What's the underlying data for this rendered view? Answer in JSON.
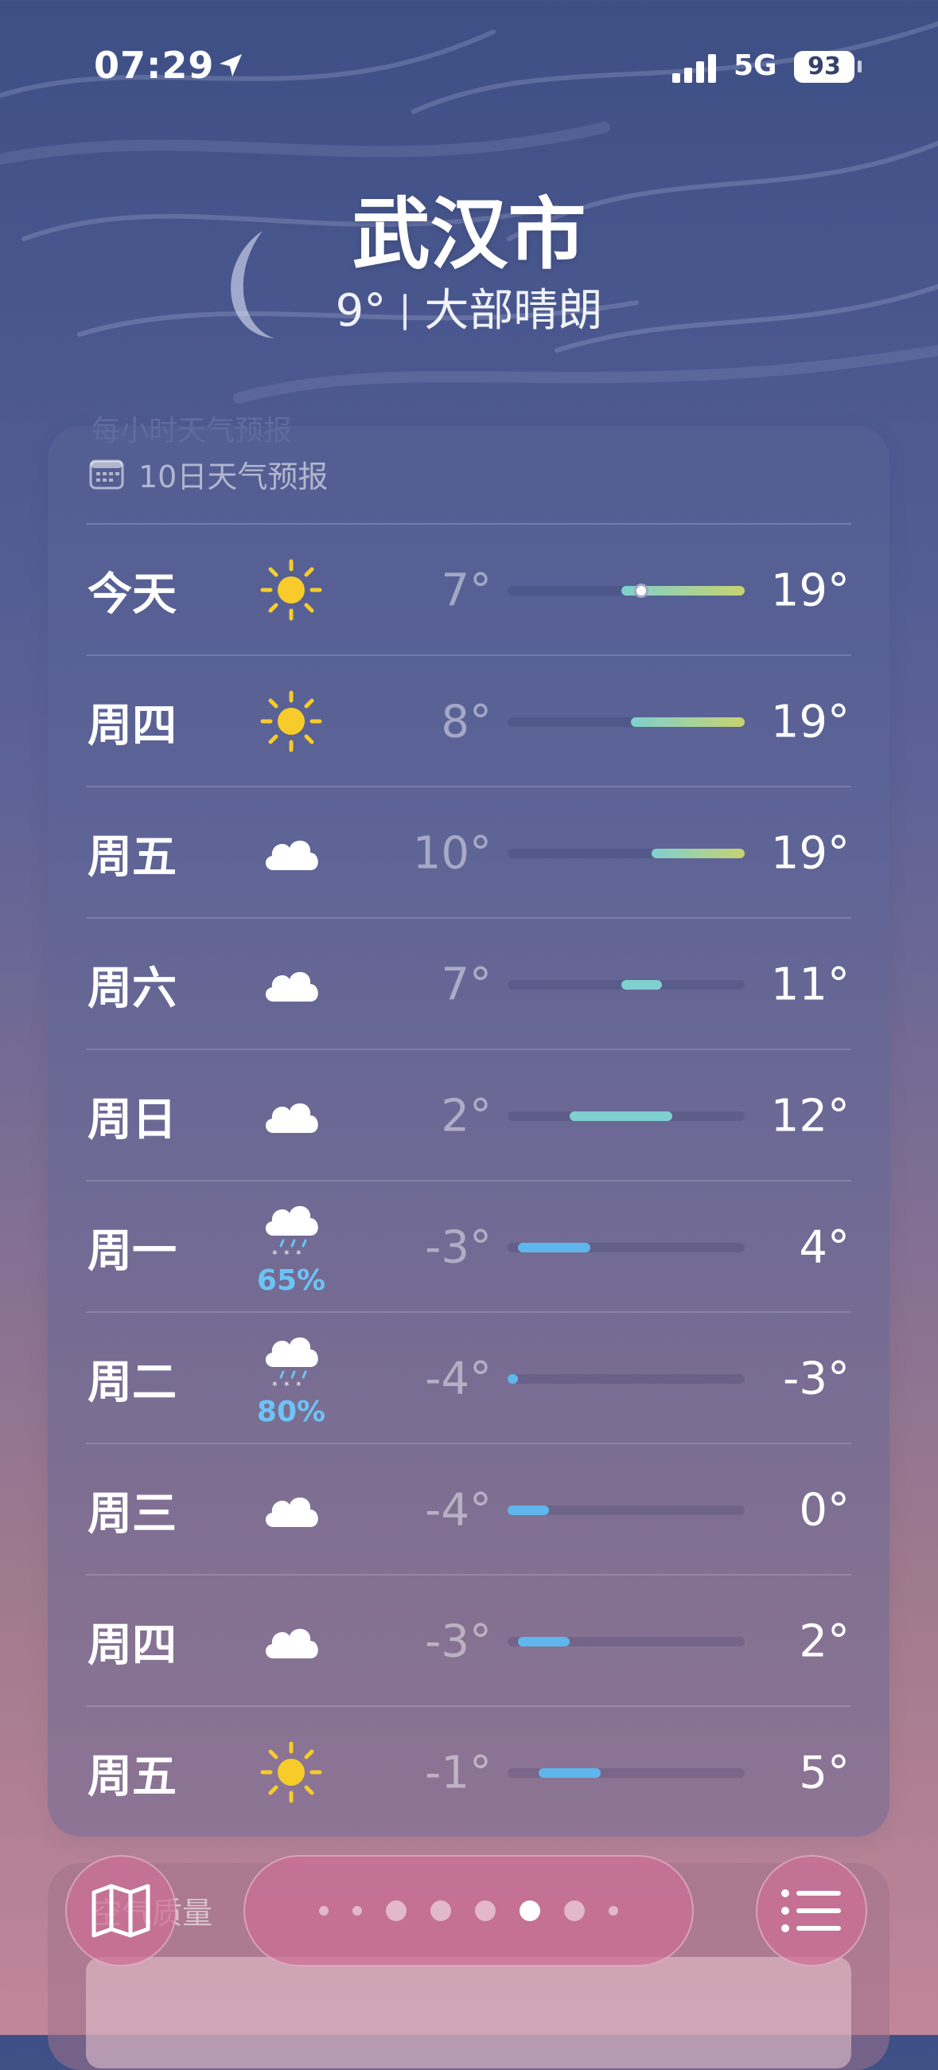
{
  "status_bar": {
    "time": "07:29",
    "network": "5G",
    "battery": "93"
  },
  "location": {
    "city": "武汉市",
    "temperature": "9°",
    "condition": "大部晴朗"
  },
  "hourly_header_ghost": "每小时天气预报",
  "forecast": {
    "title": "10日天气预报",
    "days": [
      {
        "day": "今天",
        "icon": "sun-icon",
        "precip": "",
        "low": "7°",
        "high": "19°"
      },
      {
        "day": "周四",
        "icon": "sun-icon",
        "precip": "",
        "low": "8°",
        "high": "19°"
      },
      {
        "day": "周五",
        "icon": "cloud-icon",
        "precip": "",
        "low": "10°",
        "high": "19°"
      },
      {
        "day": "周六",
        "icon": "cloud-icon",
        "precip": "",
        "low": "7°",
        "high": "11°"
      },
      {
        "day": "周日",
        "icon": "cloud-icon",
        "precip": "",
        "low": "2°",
        "high": "12°"
      },
      {
        "day": "周一",
        "icon": "snow-cloud-icon",
        "precip": "65%",
        "low": "-3°",
        "high": "4°"
      },
      {
        "day": "周二",
        "icon": "snow-cloud-icon",
        "precip": "80%",
        "low": "-4°",
        "high": "-3°"
      },
      {
        "day": "周三",
        "icon": "cloud-icon",
        "precip": "",
        "low": "-4°",
        "high": "0°"
      },
      {
        "day": "周四",
        "icon": "cloud-icon",
        "precip": "",
        "low": "-3°",
        "high": "2°"
      },
      {
        "day": "周五",
        "icon": "sun-icon",
        "precip": "",
        "low": "-1°",
        "high": "5°"
      }
    ]
  },
  "air_quality": {
    "title": "空气质量"
  },
  "colors": {
    "sun": "#f7cc2a",
    "precip": "#6cc4f5",
    "cold_bar": "#5fb6ec",
    "warm_bar": "#c7d36f",
    "mild_bar": "#7fd0cf"
  }
}
